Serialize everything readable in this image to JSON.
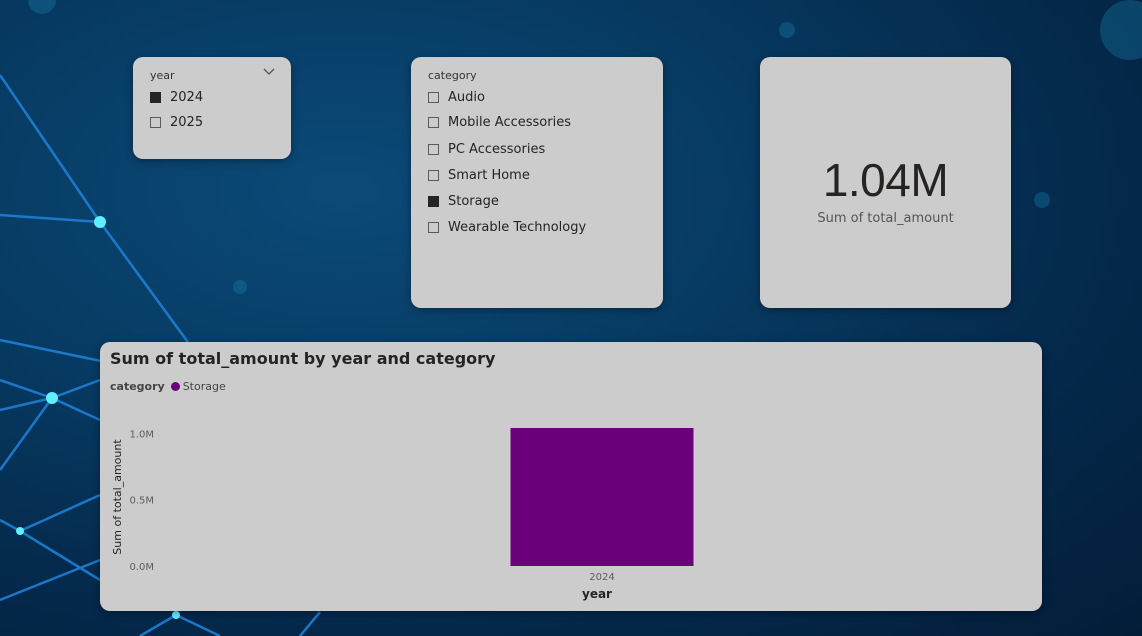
{
  "year_slicer": {
    "title": "year",
    "items": [
      {
        "label": "2024",
        "checked": true
      },
      {
        "label": "2025",
        "checked": false
      }
    ]
  },
  "category_slicer": {
    "title": "category",
    "items": [
      {
        "label": "Audio",
        "checked": false
      },
      {
        "label": "Mobile Accessories",
        "checked": false
      },
      {
        "label": "PC Accessories",
        "checked": false
      },
      {
        "label": "Smart Home",
        "checked": false
      },
      {
        "label": "Storage",
        "checked": true
      },
      {
        "label": "Wearable Technology",
        "checked": false
      }
    ]
  },
  "kpi": {
    "value": "1.04M",
    "label": "Sum of total_amount"
  },
  "colors": {
    "bar": "#6b007b",
    "card": "#cccccc"
  },
  "chart_data": {
    "type": "bar",
    "title": "Sum of total_amount by year and category",
    "legend_title": "category",
    "legend_placement": "top-left",
    "categories": [
      "2024"
    ],
    "series": [
      {
        "name": "Storage",
        "values": [
          1040000
        ],
        "color": "#6b007b"
      }
    ],
    "xlabel": "year",
    "ylabel": "Sum of total_amount",
    "yticks": [
      {
        "value": 0,
        "label": "0.0M"
      },
      {
        "value": 500000,
        "label": "0.5M"
      },
      {
        "value": 1000000,
        "label": "1.0M"
      }
    ],
    "ylim": [
      0,
      1040000
    ],
    "grid": false
  }
}
